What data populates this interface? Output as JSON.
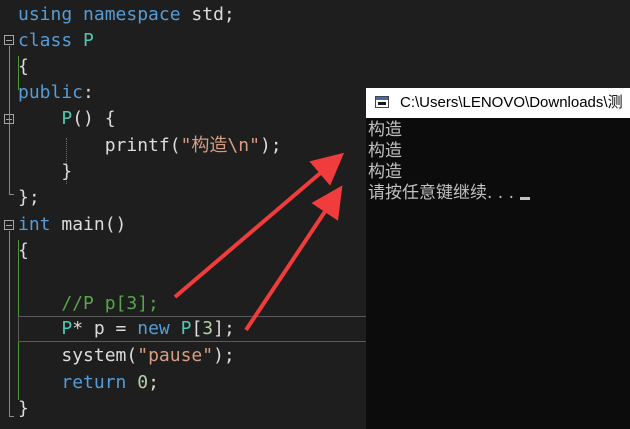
{
  "code": {
    "l1": {
      "kw": "using namespace",
      "rest": " std;"
    },
    "l2": {
      "kw": "class",
      "name": "P"
    },
    "l3": "{",
    "l4": {
      "kw": "public",
      "colon": ":"
    },
    "l5": {
      "ctor": "P",
      "rest": "() {"
    },
    "l6": {
      "fn": "printf",
      "open": "(",
      "str": "\"构造\\n\"",
      "close": ");"
    },
    "l7": "}",
    "l8": "};",
    "l9": {
      "kw": "int",
      "rest": " main()"
    },
    "l10": "{",
    "l11": "//P p[3];",
    "l12": {
      "type": "P",
      "a": "* p = ",
      "new": "new",
      "sp": " ",
      "type2": "P",
      "b": "[",
      "num": "3",
      "c": "];"
    },
    "l13": {
      "fn": "system",
      "open": "(",
      "str": "\"pause\"",
      "close": ");"
    },
    "l14": {
      "kw": "return",
      "sp": " ",
      "num": "0",
      "end": ";"
    },
    "l15": "}"
  },
  "console": {
    "title": "C:\\Users\\LENOVO\\Downloads\\测",
    "lines": [
      "构造",
      "构造",
      "构造",
      "请按任意键继续. . ."
    ]
  },
  "colors": {
    "editor_bg": "#1e1e1e",
    "keyword": "#569cd6",
    "type": "#4ec9b0",
    "string": "#d69d85",
    "comment": "#57a64a",
    "console_bg": "#0c0c0c",
    "arrow": "#f03c3c"
  },
  "icons": [
    "fold-collapse-icon",
    "console-app-icon",
    "red-arrow"
  ]
}
